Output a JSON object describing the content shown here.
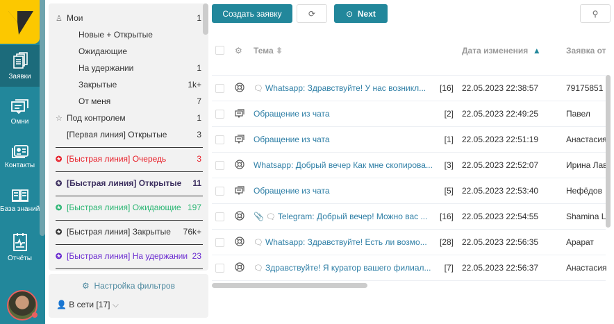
{
  "nav": {
    "items": [
      {
        "label": "Заявки",
        "active": true
      },
      {
        "label": "Омни"
      },
      {
        "label": "Контакты"
      },
      {
        "label": "База знаний"
      },
      {
        "label": "Отчёты"
      }
    ]
  },
  "filters": {
    "items": [
      {
        "label": "Мои",
        "count": "1",
        "icon": "user-icon"
      },
      {
        "label": "Новые + Открытые",
        "count": ""
      },
      {
        "label": "Ожидающие",
        "count": ""
      },
      {
        "label": "На удержании",
        "count": "1"
      },
      {
        "label": "Закрытые",
        "count": "1k+"
      },
      {
        "label": "От меня",
        "count": "7"
      },
      {
        "label": "Под контролем",
        "count": "1",
        "icon": "star-icon"
      },
      {
        "label": "[Первая линия] Открытые",
        "count": "3"
      }
    ],
    "queues": [
      {
        "label": "[Быстрая линия] Очередь",
        "count": "3",
        "color": "#e8202a"
      },
      {
        "label": "[Быстрая линия] Открытые",
        "count": "11",
        "color": "#3d3060"
      },
      {
        "label": "[Быстрая линия] Ожидающие",
        "count": "197",
        "color": "#2bb673"
      },
      {
        "label": "[Быстрая линия] Закрытые",
        "count": "76k+",
        "color": "#333333"
      },
      {
        "label": "[Быстрая линия] На удержании",
        "count": "23",
        "color": "#6a2bd0"
      }
    ],
    "settings": "Настройка фильтров",
    "online": "В сети [17]"
  },
  "toolbar": {
    "create": "Создать заявку",
    "next": "Next"
  },
  "table": {
    "headers": {
      "topic": "Тема",
      "date": "Дата изменения",
      "from": "Заявка от"
    },
    "rows": [
      {
        "type": "lifebuoy",
        "sub": "chat",
        "topic": "Whatsapp: Здравствуйте! У нас возникл...",
        "count": "[16]",
        "date": "22.05.2023 22:38:57",
        "from": "79175851"
      },
      {
        "type": "chat-screen",
        "sub": "",
        "topic": "Обращение из чата",
        "count": "[2]",
        "date": "22.05.2023 22:49:25",
        "from": "Павел"
      },
      {
        "type": "chat-screen",
        "sub": "",
        "topic": "Обращение из чата",
        "count": "[1]",
        "date": "22.05.2023 22:51:19",
        "from": "Анастасия"
      },
      {
        "type": "lifebuoy",
        "sub": "",
        "topic": "Whatsapp: Добрый вечер Как мне скопирова...",
        "count": "[3]",
        "date": "22.05.2023 22:52:07",
        "from": "Ирина Лав"
      },
      {
        "type": "chat-screen",
        "sub": "",
        "topic": "Обращение из чата",
        "count": "[5]",
        "date": "22.05.2023 22:53:40",
        "from": "Нефёдов"
      },
      {
        "type": "lifebuoy",
        "sub": "attach-chat",
        "topic": "Telegram: Добрый вечер! Можно вас ...",
        "count": "[16]",
        "date": "22.05.2023 22:54:55",
        "from": "Shamina L"
      },
      {
        "type": "lifebuoy",
        "sub": "chat",
        "topic": "Whatsapp: Здравствуйте! Есть ли возмо...",
        "count": "[28]",
        "date": "22.05.2023 22:56:35",
        "from": "Арарат"
      },
      {
        "type": "lifebuoy",
        "sub": "chat",
        "topic": "Здравствуйте! Я куратор вашего филиал...",
        "count": "[7]",
        "date": "22.05.2023 22:56:37",
        "from": "Анастасия"
      }
    ]
  },
  "colors": {
    "brand": "#22879b",
    "logo": "#fcc800",
    "link": "#2f7fa6"
  }
}
